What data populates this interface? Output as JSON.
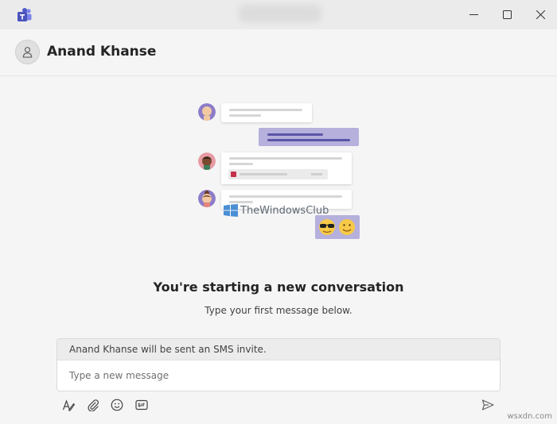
{
  "window": {
    "controls": {
      "minimize": "minimize",
      "maximize": "maximize",
      "close": "close"
    }
  },
  "chat": {
    "contact_name": "Anand Khanse"
  },
  "empty_state": {
    "headline": "You're starting a new conversation",
    "subline": "Type your first message below."
  },
  "watermark": {
    "text": "TheWindowsClub"
  },
  "compose": {
    "sms_notice": "Anand Khanse will be sent an SMS invite.",
    "placeholder": "Type a new message"
  },
  "toolbar": {
    "icons": [
      "format-icon",
      "attach-icon",
      "emoji-icon",
      "gif-icon",
      "send-icon"
    ]
  },
  "footer": {
    "site_mark": "wsxdn.com"
  },
  "colors": {
    "accent": "#6264a7",
    "purple_bubble": "#b5b0dc",
    "background": "#f5f5f5"
  }
}
